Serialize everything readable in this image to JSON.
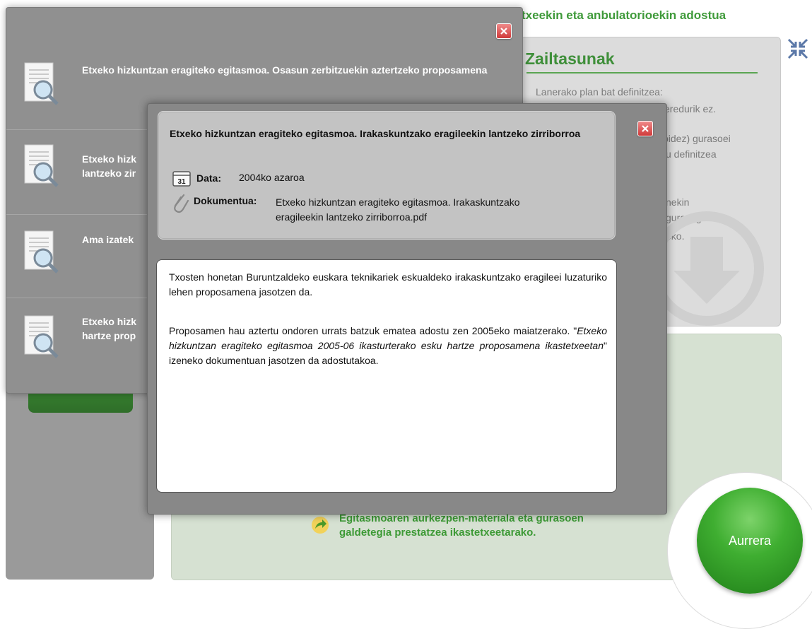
{
  "background": {
    "header_fragment": "txeekin eta anbulatorioekin adostua",
    "difficulties": {
      "title": "Zailtasunak",
      "lines": [
        "Lanerako plan bat definitzea:",
        "eredurik ez.",
        "pidez) gurasoei",
        "u definitzea",
        "nekin",
        "gurasogai\"",
        "eko."
      ]
    },
    "next_step_link": {
      "line1": "Egitasmoaren aurkezpen-materiala eta gurasoen",
      "line2": "galdetegia prestatzea ikastetxeetarako."
    },
    "next_button_label": "Aurrera"
  },
  "document_list": {
    "items": [
      {
        "title": "Etxeko hizkuntzan eragiteko egitasmoa. Osasun zerbitzuekin aztertzeko proposamena"
      },
      {
        "title": "Etxeko hizk",
        "title_line2": "lantzeko zir"
      },
      {
        "title": "Ama izatek"
      },
      {
        "title": "Etxeko hizk",
        "title_line2": "hartze prop"
      }
    ]
  },
  "document_detail": {
    "title": "Etxeko hizkuntzan eragiteko egitasmoa. Irakaskuntzako eragileekin lantzeko zirriborroa",
    "calendar_day": "31",
    "date_label": "Data:",
    "date_value": "2004ko azaroa",
    "doc_label": "Dokumentua:",
    "doc_value_line1": "Etxeko hizkuntzan eragiteko egitasmoa. Irakaskuntzako",
    "doc_value_line2": "eragileekin lantzeko zirriborroa.pdf",
    "paragraph1": "Txosten honetan Buruntzaldeko euskara teknikariek eskualdeko irakaskuntzako eragileei luzaturiko lehen proposamena jasotzen da.",
    "paragraph2_before": "Proposamen hau aztertu ondoren urrats batzuk ematea adostu zen 2005eko maiatzerako. \"",
    "paragraph2_italic": "Etxeko hizkuntzan eragiteko egitasmoa 2005-06 ikasturterako esku hartze proposamena ikastetxeetan",
    "paragraph2_after": "\" izeneko dokumentuan jasotzen da adostutakoa."
  },
  "colors": {
    "accent_green": "#3f9a3a",
    "modal_gray": "#888888",
    "close_red": "#d03a3a"
  }
}
